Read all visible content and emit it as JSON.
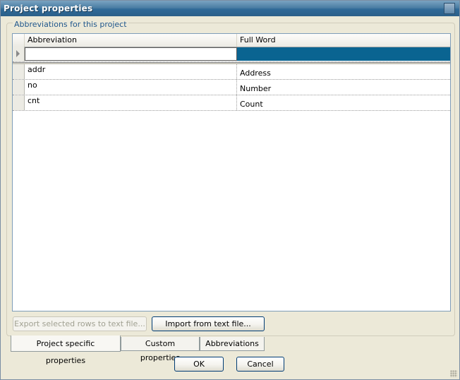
{
  "window": {
    "title": "Project properties"
  },
  "group": {
    "legend": "Abbreviations for this project"
  },
  "grid": {
    "columns": [
      "Abbreviation",
      "Full Word"
    ],
    "new_row": {
      "abbreviation": "",
      "full_word": ""
    },
    "rows": [
      {
        "abbreviation": "addr",
        "full_word": "Address"
      },
      {
        "abbreviation": "no",
        "full_word": "Number"
      },
      {
        "abbreviation": "cnt",
        "full_word": "Count"
      }
    ]
  },
  "buttons": {
    "export": "Export selected rows to text file...",
    "import": "Import from text file...",
    "ok": "OK",
    "cancel": "Cancel"
  },
  "tabs": [
    {
      "label": "Project specific properties",
      "active": true
    },
    {
      "label": "Custom properties",
      "active": false
    },
    {
      "label": "Abbreviations",
      "active": false
    }
  ],
  "colors": {
    "titlebar": "#2f6a98",
    "selection": "#0a6491",
    "legend_text": "#20578c"
  }
}
